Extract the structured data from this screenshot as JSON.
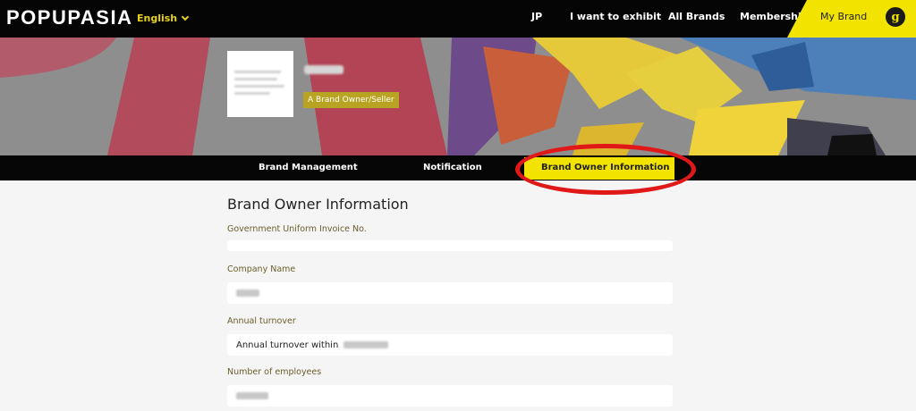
{
  "header": {
    "logo": "POPUPASIA",
    "language": "English",
    "nav": [
      "JP",
      "I want to exhibit",
      "All Brands",
      "Membership"
    ],
    "my_brand": "My Brand",
    "user_initial": "g"
  },
  "profile": {
    "role_badge": "A Brand Owner/Seller"
  },
  "tabs": {
    "brand_management": "Brand Management",
    "notification": "Notification",
    "owner_info": "Brand Owner Information"
  },
  "form": {
    "title": "Brand Owner Information",
    "gov_invoice_label": "Government Uniform Invoice No.",
    "company_name_label": "Company Name",
    "annual_turnover_label": "Annual turnover",
    "annual_turnover_value": "Annual turnover within",
    "employees_label": "Number of employees"
  },
  "colors": {
    "accent": "#f2e300",
    "annotation": "#e11818",
    "label": "#6b5e2a"
  }
}
